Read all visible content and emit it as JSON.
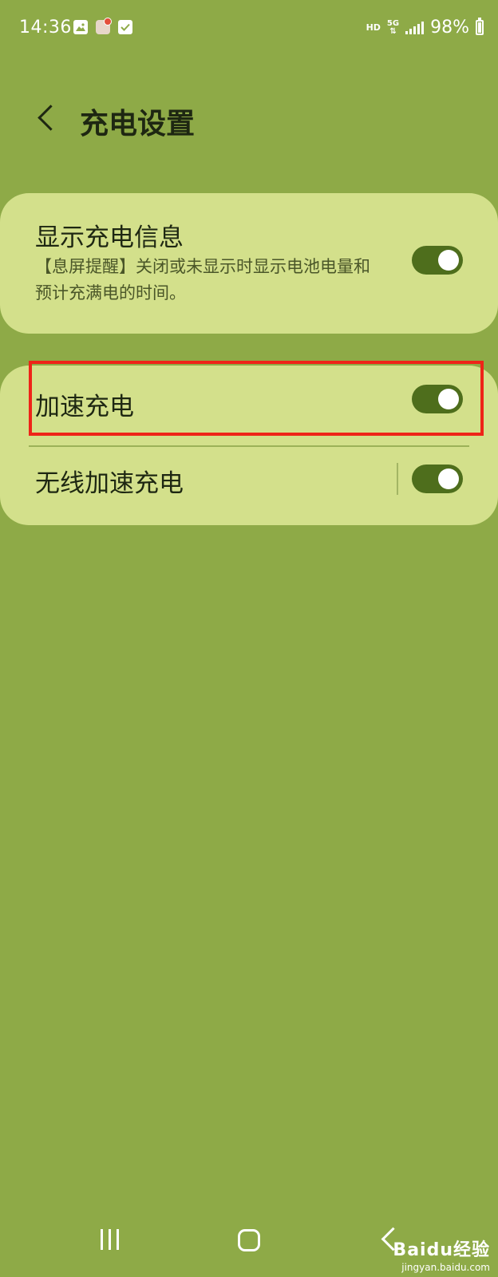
{
  "status_bar": {
    "time": "14:36",
    "network_hd": "HD",
    "network_type": "5G",
    "battery_percent": "98%"
  },
  "header": {
    "title": "充电设置"
  },
  "settings": {
    "show_charging_info": {
      "title": "显示充电信息",
      "description": "【息屏提醒】关闭或未显示时显示电池电量和预计充满电的时间。",
      "enabled": true
    },
    "fast_charging": {
      "title": "加速充电",
      "enabled": true
    },
    "fast_wireless_charging": {
      "title": "无线加速充电",
      "enabled": true
    }
  },
  "watermark": {
    "main": "Baidu经验",
    "sub": "jingyan.baidu.com"
  },
  "colors": {
    "background": "#8eaa47",
    "card": "#d3e08b",
    "toggle_on": "#4e6e1c",
    "highlight": "#ee2418"
  }
}
